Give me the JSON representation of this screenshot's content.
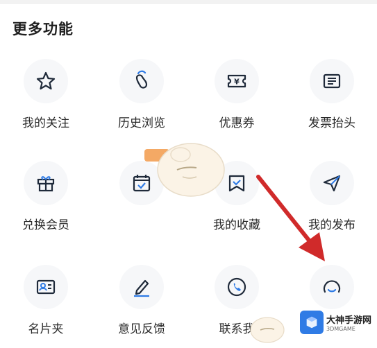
{
  "section": {
    "title": "更多功能"
  },
  "items": [
    {
      "label": "我的关注",
      "icon": "star-icon"
    },
    {
      "label": "历史浏览",
      "icon": "footprint-icon"
    },
    {
      "label": "优惠券",
      "icon": "coupon-icon"
    },
    {
      "label": "发票抬头",
      "icon": "invoice-icon"
    },
    {
      "label": "兑换会员",
      "icon": "gift-icon"
    },
    {
      "label": "",
      "icon": "calendar-check-icon"
    },
    {
      "label": "我的收藏",
      "icon": "bookmark-icon"
    },
    {
      "label": "我的发布",
      "icon": "send-icon"
    },
    {
      "label": "名片夹",
      "icon": "id-card-icon"
    },
    {
      "label": "意见反馈",
      "icon": "pen-icon"
    },
    {
      "label": "联系我",
      "icon": "phone-icon"
    },
    {
      "label": "",
      "icon": "chat-icon"
    }
  ],
  "watermark": {
    "title": "大神手游网",
    "sub": "3DMGAME"
  },
  "colors": {
    "icon": "#1f2a3a",
    "accent": "#2f7be5",
    "arrow": "#d02a2a"
  }
}
